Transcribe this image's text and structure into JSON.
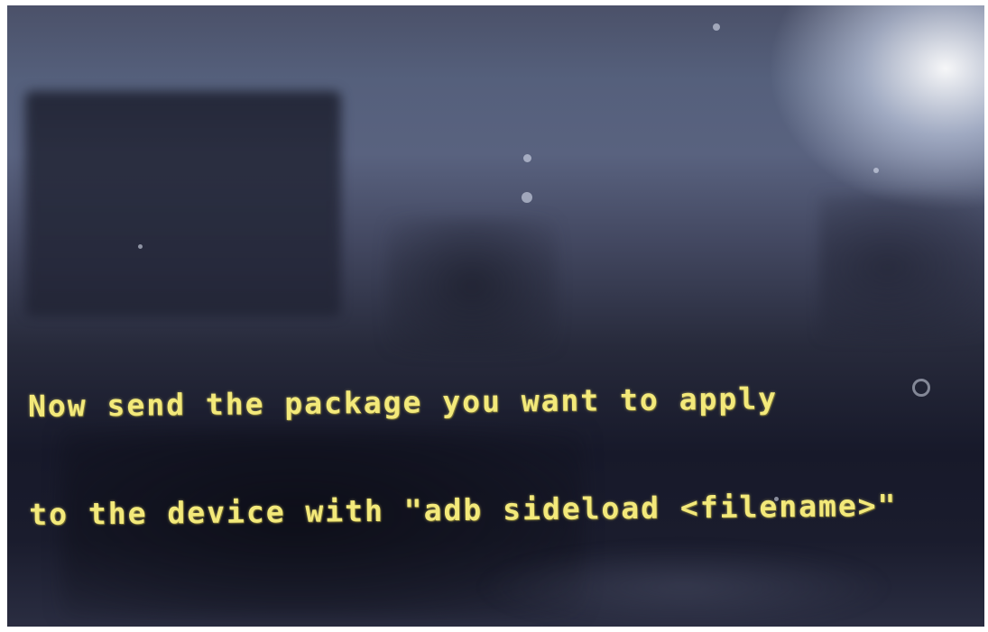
{
  "screen": {
    "message_lines": [
      "Now send the package you want to apply",
      "to the device with \"adb sideload <filename>\""
    ],
    "text_color": "#f3e97a",
    "background_color": "#1a1c2d"
  }
}
